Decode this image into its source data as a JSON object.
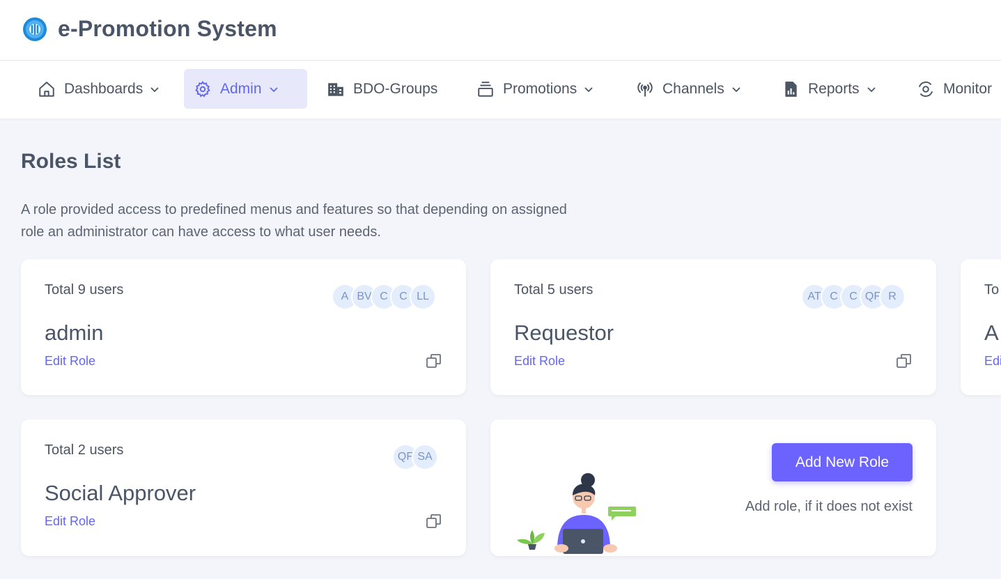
{
  "app": {
    "title": "e-Promotion System"
  },
  "nav": {
    "items": [
      {
        "label": "Dashboards",
        "icon": "home-icon",
        "has_dropdown": true,
        "active": false
      },
      {
        "label": "Admin",
        "icon": "gear-icon",
        "has_dropdown": true,
        "active": true
      },
      {
        "label": "BDO-Groups",
        "icon": "building-icon",
        "has_dropdown": false,
        "active": false
      },
      {
        "label": "Promotions",
        "icon": "stack-icon",
        "has_dropdown": true,
        "active": false
      },
      {
        "label": "Channels",
        "icon": "antenna-icon",
        "has_dropdown": true,
        "active": false
      },
      {
        "label": "Reports",
        "icon": "report-icon",
        "has_dropdown": true,
        "active": false
      },
      {
        "label": "Monitor",
        "icon": "monitor-icon",
        "has_dropdown": false,
        "active": false
      }
    ]
  },
  "page": {
    "title": "Roles List",
    "description": "A role provided access to predefined menus and features so that depending on assigned role an administrator can have access to what user needs."
  },
  "roles": [
    {
      "total": "Total 9 users",
      "name": "admin",
      "edit_label": "Edit Role",
      "avatars": [
        "A",
        "BV",
        "C",
        "C",
        "LL"
      ]
    },
    {
      "total": "Total 5 users",
      "name": "Requestor",
      "edit_label": "Edit Role",
      "avatars": [
        "AT",
        "C",
        "C",
        "QF",
        "R"
      ]
    },
    {
      "total": "To",
      "name": "A",
      "edit_label": "Edi",
      "avatars": []
    },
    {
      "total": "Total 2 users",
      "name": "Social Approver",
      "edit_label": "Edit Role",
      "avatars": [
        "QF",
        "SA"
      ]
    }
  ],
  "add_role": {
    "button_label": "Add New Role",
    "hint": "Add role, if it does not exist"
  },
  "colors": {
    "accent": "#6c63ff",
    "active_nav_bg": "#e8e8fb",
    "page_bg": "#f4f5fa"
  }
}
